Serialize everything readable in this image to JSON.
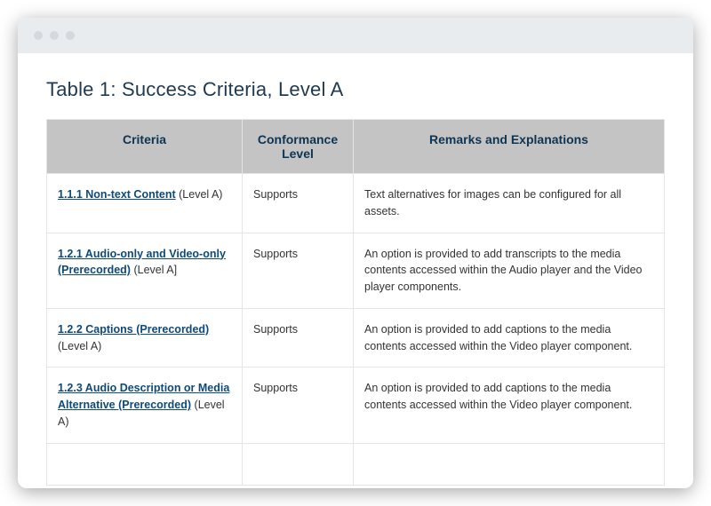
{
  "page": {
    "title": "Table 1: Success Criteria, Level A"
  },
  "table": {
    "headers": {
      "criteria": "Criteria",
      "conformance": "Conformance Level",
      "remarks": "Remarks and Explanations"
    },
    "rows": [
      {
        "criteria_link": "1.1.1 Non-text Content",
        "criteria_level": " (Level A)",
        "conformance": "Supports",
        "remarks": "Text alternatives for images can be configured for all assets."
      },
      {
        "criteria_link": "1.2.1 Audio-only and Video-only (Prerecorded)",
        "criteria_level": " (Level A]",
        "conformance": "Supports",
        "remarks": "An option is provided to add transcripts to the media contents accessed within the Audio player and the Video player components."
      },
      {
        "criteria_link": "1.2.2 Captions (Prerecorded)",
        "criteria_level": " (Level A)",
        "conformance": "Supports",
        "remarks": "An option is provided to add captions to the media contents accessed within the Video player component."
      },
      {
        "criteria_link": "1.2.3 Audio Description or Media Alternative (Prerecorded)",
        "criteria_level": " (Level A)",
        "conformance": "Supports",
        "remarks": "An option is provided to add captions to the media contents accessed within the Video player component."
      }
    ]
  }
}
